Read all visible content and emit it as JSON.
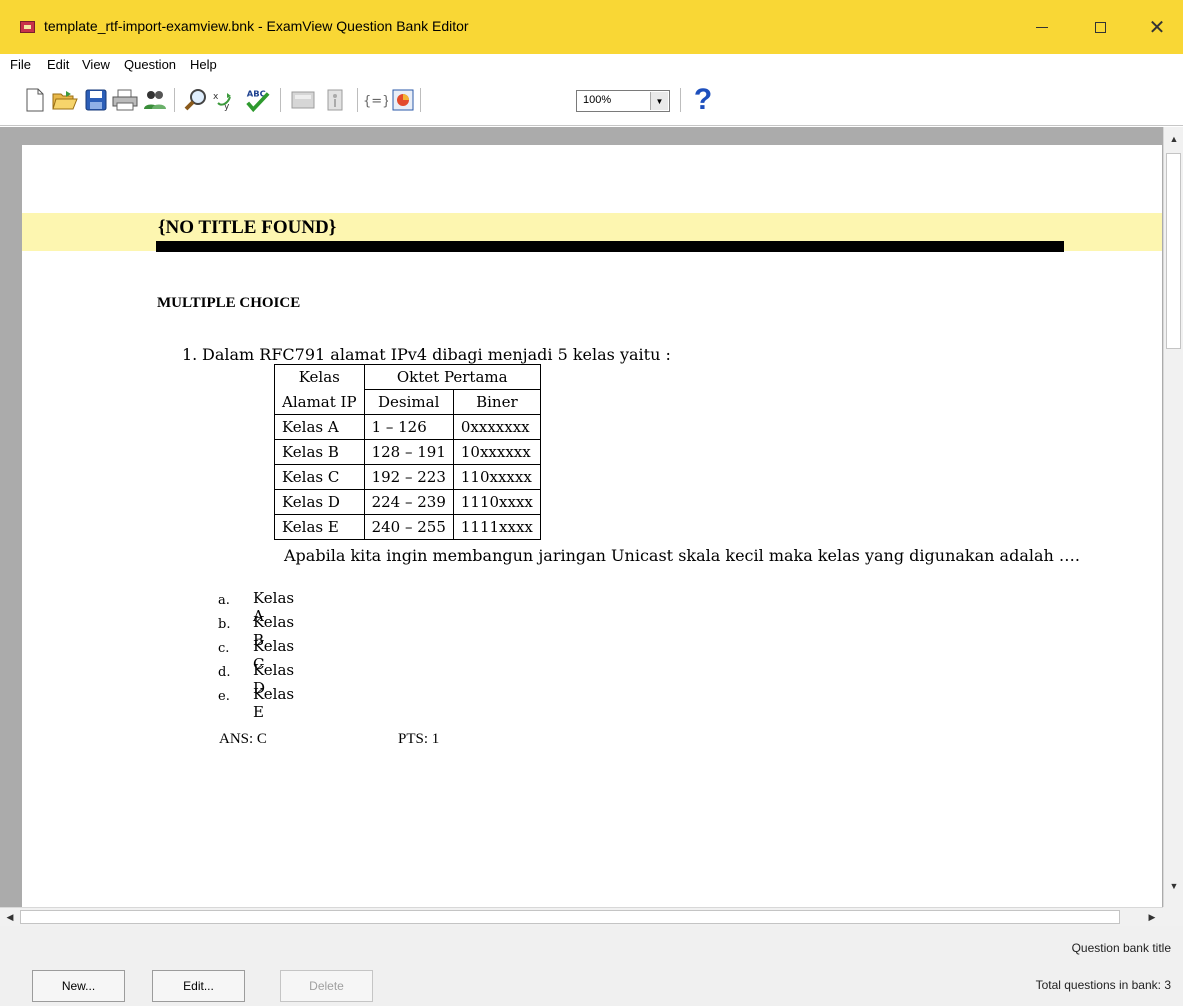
{
  "window": {
    "title": "template_rtf-import-examview.bnk - ExamView Question Bank Editor",
    "close_symbol": "✕"
  },
  "menu": {
    "items": [
      "File",
      "Edit",
      "View",
      "Question",
      "Help"
    ]
  },
  "toolbar": {
    "icons": [
      "new-file-icon",
      "open-folder-icon",
      "save-icon",
      "print-icon",
      "users-icon",
      "search-icon",
      "variables-icon",
      "spellcheck-icon",
      "calculator-icon",
      "info-icon",
      "equation-icon",
      "chart-icon",
      "help-icon"
    ],
    "zoom": "100%",
    "help_symbol": "?"
  },
  "document": {
    "title": "{NO TITLE FOUND}",
    "section": "MULTIPLE CHOICE",
    "question": {
      "number": "1.",
      "stem": "Dalam RFC791 alamat IPv4 dibagi menjadi 5 kelas yaitu :",
      "table": {
        "header_col1_line1": "Kelas",
        "header_col1_line2": "Alamat IP",
        "header_group": "Oktet Pertama",
        "header_desimal": "Desimal",
        "header_biner": "Biner",
        "rows": [
          {
            "kelas": "Kelas A",
            "desimal": "1 – 126",
            "biner": "0xxxxxxx"
          },
          {
            "kelas": "Kelas B",
            "desimal": "128 – 191",
            "biner": "10xxxxxx"
          },
          {
            "kelas": "Kelas C",
            "desimal": "192 – 223",
            "biner": "110xxxxx"
          },
          {
            "kelas": "Kelas D",
            "desimal": "224 – 239",
            "biner": "1110xxxx"
          },
          {
            "kelas": "Kelas E",
            "desimal": "240 – 255",
            "biner": "1111xxxx"
          }
        ]
      },
      "stem_continued": "Apabila kita ingin membangun jaringan Unicast skala kecil maka kelas yang digunakan adalah ….",
      "choices": [
        {
          "letter": "a.",
          "text": "Kelas A"
        },
        {
          "letter": "b.",
          "text": "Kelas B"
        },
        {
          "letter": "c.",
          "text": "Kelas C"
        },
        {
          "letter": "d.",
          "text": "Kelas D"
        },
        {
          "letter": "e.",
          "text": "Kelas E"
        }
      ],
      "answer": "ANS:  C",
      "points": "PTS:  1"
    }
  },
  "footer": {
    "bank_title_label": "Question bank title",
    "total_questions": "Total questions in bank: 3",
    "buttons": {
      "new": "New...",
      "edit": "Edit...",
      "delete": "Delete"
    }
  },
  "colors": {
    "titlebar": "#f9d735",
    "title_band": "#fdf6b0",
    "doc_background": "#ababab"
  }
}
